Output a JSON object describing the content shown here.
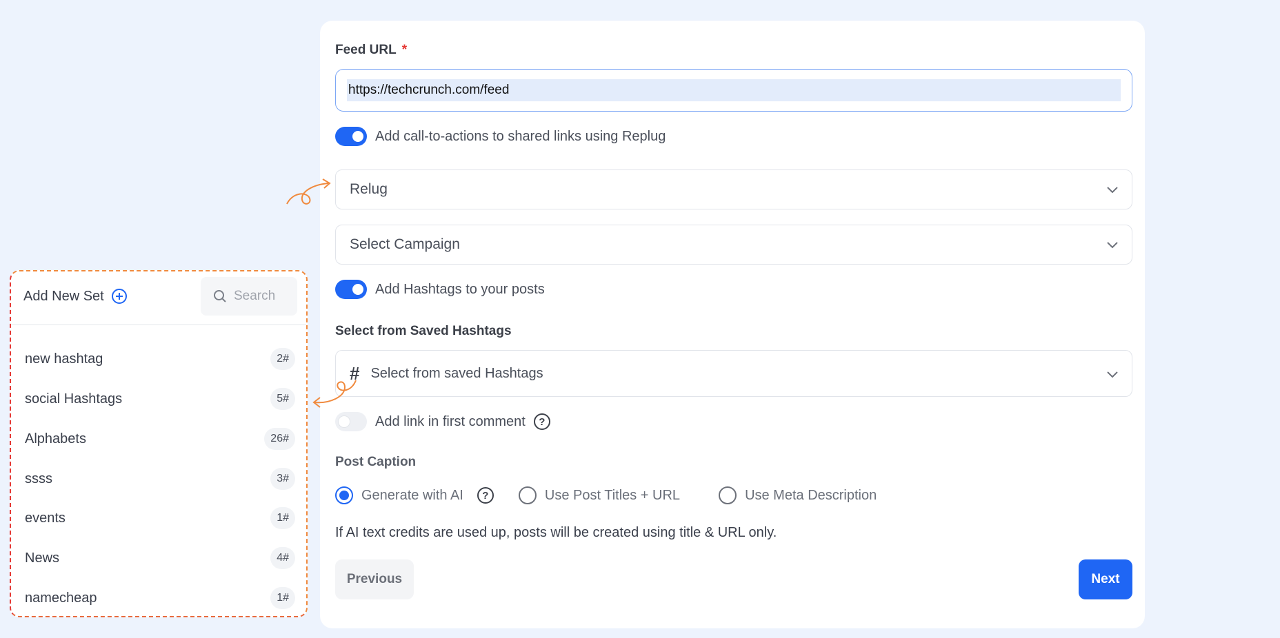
{
  "form": {
    "feed_url_label": "Feed URL",
    "required_mark": "*",
    "feed_url_value": "https://techcrunch.com/feed",
    "cta_toggle_label": "Add call-to-actions to shared links using Replug",
    "cta_toggle_on": true,
    "replug_select_value": "Relug",
    "campaign_select_placeholder": "Select Campaign",
    "hashtags_toggle_label": "Add Hashtags to your posts",
    "hashtags_toggle_on": true,
    "saved_hashtags_label": "Select from Saved Hashtags",
    "saved_hashtags_placeholder": "Select from saved Hashtags",
    "first_comment_label": "Add link in first comment",
    "first_comment_on": false,
    "post_caption_label": "Post Caption",
    "caption_options": [
      {
        "label": "Generate with AI",
        "selected": true
      },
      {
        "label": "Use Post Titles + URL",
        "selected": false
      },
      {
        "label": "Use Meta Description",
        "selected": false
      }
    ],
    "note": "If AI text credits are used up, posts will be created using title & URL only.",
    "previous_label": "Previous",
    "next_label": "Next"
  },
  "hashtag_panel": {
    "add_new_set_label": "Add New Set",
    "search_placeholder": "Search",
    "sets": [
      {
        "name": "new hashtag",
        "count": "2#"
      },
      {
        "name": "social Hashtags",
        "count": "5#"
      },
      {
        "name": "Alphabets",
        "count": "26#"
      },
      {
        "name": "ssss",
        "count": "3#"
      },
      {
        "name": "events",
        "count": "1#"
      },
      {
        "name": "News",
        "count": "4#"
      },
      {
        "name": "namecheap",
        "count": "1#"
      }
    ]
  },
  "colors": {
    "accent": "#1f66f4",
    "background": "#edf3fd",
    "annotation_orange": "#f08a3e",
    "annotation_red": "#e53935"
  }
}
